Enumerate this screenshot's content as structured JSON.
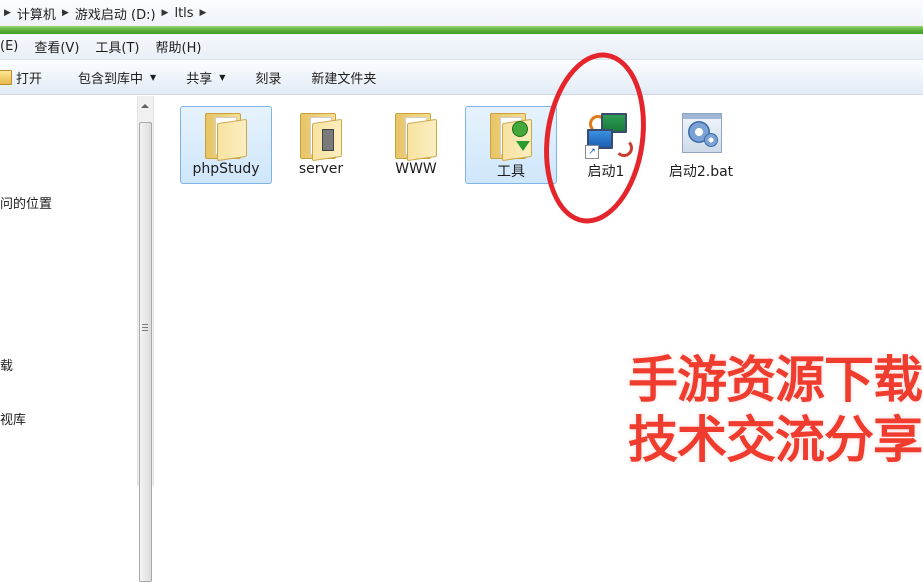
{
  "breadcrumb": {
    "items": [
      "计算机",
      "游戏启动 (D:)",
      "ltls"
    ]
  },
  "menubar": {
    "items": [
      "(E)",
      "查看(V)",
      "工具(T)",
      "帮助(H)"
    ]
  },
  "commandbar": {
    "open": "打开",
    "include_library": "包含到库中",
    "share": "共享",
    "burn": "刻录",
    "new_folder": "新建文件夹"
  },
  "navpane": {
    "items": [
      "问的位置",
      "载",
      "视库"
    ]
  },
  "files": [
    {
      "label": "phpStudy",
      "type": "folder",
      "selected": true
    },
    {
      "label": "server",
      "type": "folder",
      "selected": false
    },
    {
      "label": "WWW",
      "type": "folder",
      "selected": false
    },
    {
      "label": "工具",
      "type": "folder",
      "selected": true
    },
    {
      "label": "启动1",
      "type": "shortcut",
      "selected": false
    },
    {
      "label": "启动2.bat",
      "type": "batch",
      "selected": false
    }
  ],
  "watermark": {
    "line1": "手游资源下载",
    "line2": "技术交流分享"
  },
  "colors": {
    "annotation": "#e4252b",
    "watermark": "#f03c2f",
    "selection": "#cfe6fb"
  }
}
